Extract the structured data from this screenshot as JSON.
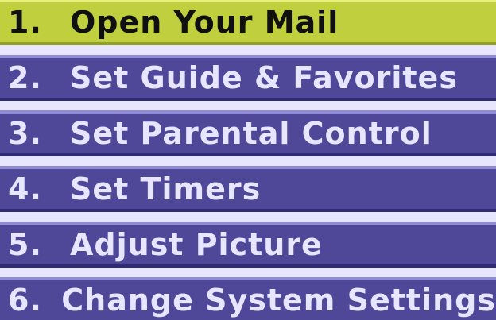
{
  "menu": {
    "items": [
      {
        "number": "1.",
        "label": "Open Your Mail"
      },
      {
        "number": "2.",
        "label": "Set Guide & Favorites"
      },
      {
        "number": "3.",
        "label": "Set Parental Control"
      },
      {
        "number": "4.",
        "label": "Set Timers"
      },
      {
        "number": "5.",
        "label": "Adjust Picture"
      },
      {
        "number": "6.",
        "label": "Change System Settings"
      }
    ],
    "selected_index": 0
  },
  "colors": {
    "selected_bg": "#bfcf3d",
    "item_bg": "#4f4898",
    "item_text": "#e7e5ff",
    "selected_text": "#101010",
    "background": "#e8e6ff"
  }
}
